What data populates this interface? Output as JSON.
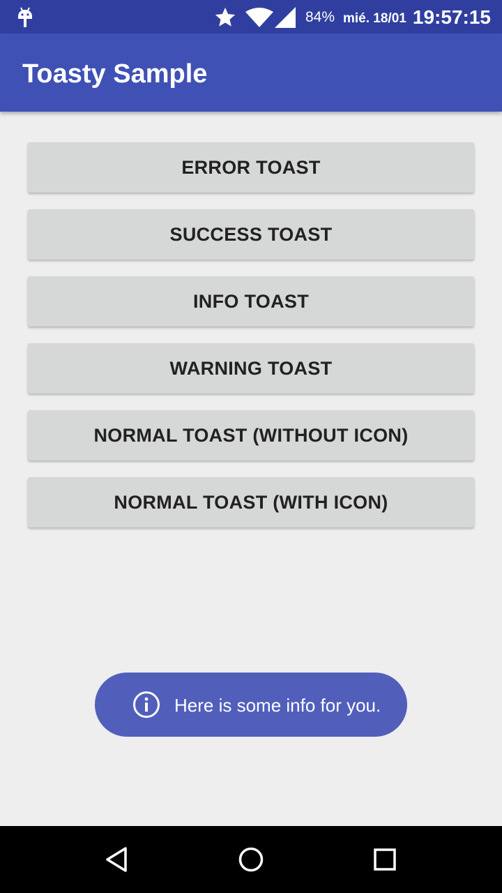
{
  "status_bar": {
    "battery": "84%",
    "date": "mié. 18/01",
    "time": "19:57:15"
  },
  "app_bar": {
    "title": "Toasty Sample",
    "color": "#3f51b5"
  },
  "buttons": [
    {
      "label": "ERROR TOAST"
    },
    {
      "label": "SUCCESS TOAST"
    },
    {
      "label": "INFO TOAST"
    },
    {
      "label": "WARNING TOAST"
    },
    {
      "label": "NORMAL TOAST (WITHOUT ICON)"
    },
    {
      "label": "NORMAL TOAST (WITH ICON)"
    }
  ],
  "toast": {
    "icon": "info-icon",
    "message": "Here is some info for you.",
    "color": "#515fbb"
  },
  "nav_bar": {
    "icons": [
      "back-icon",
      "home-icon",
      "recents-icon"
    ]
  }
}
